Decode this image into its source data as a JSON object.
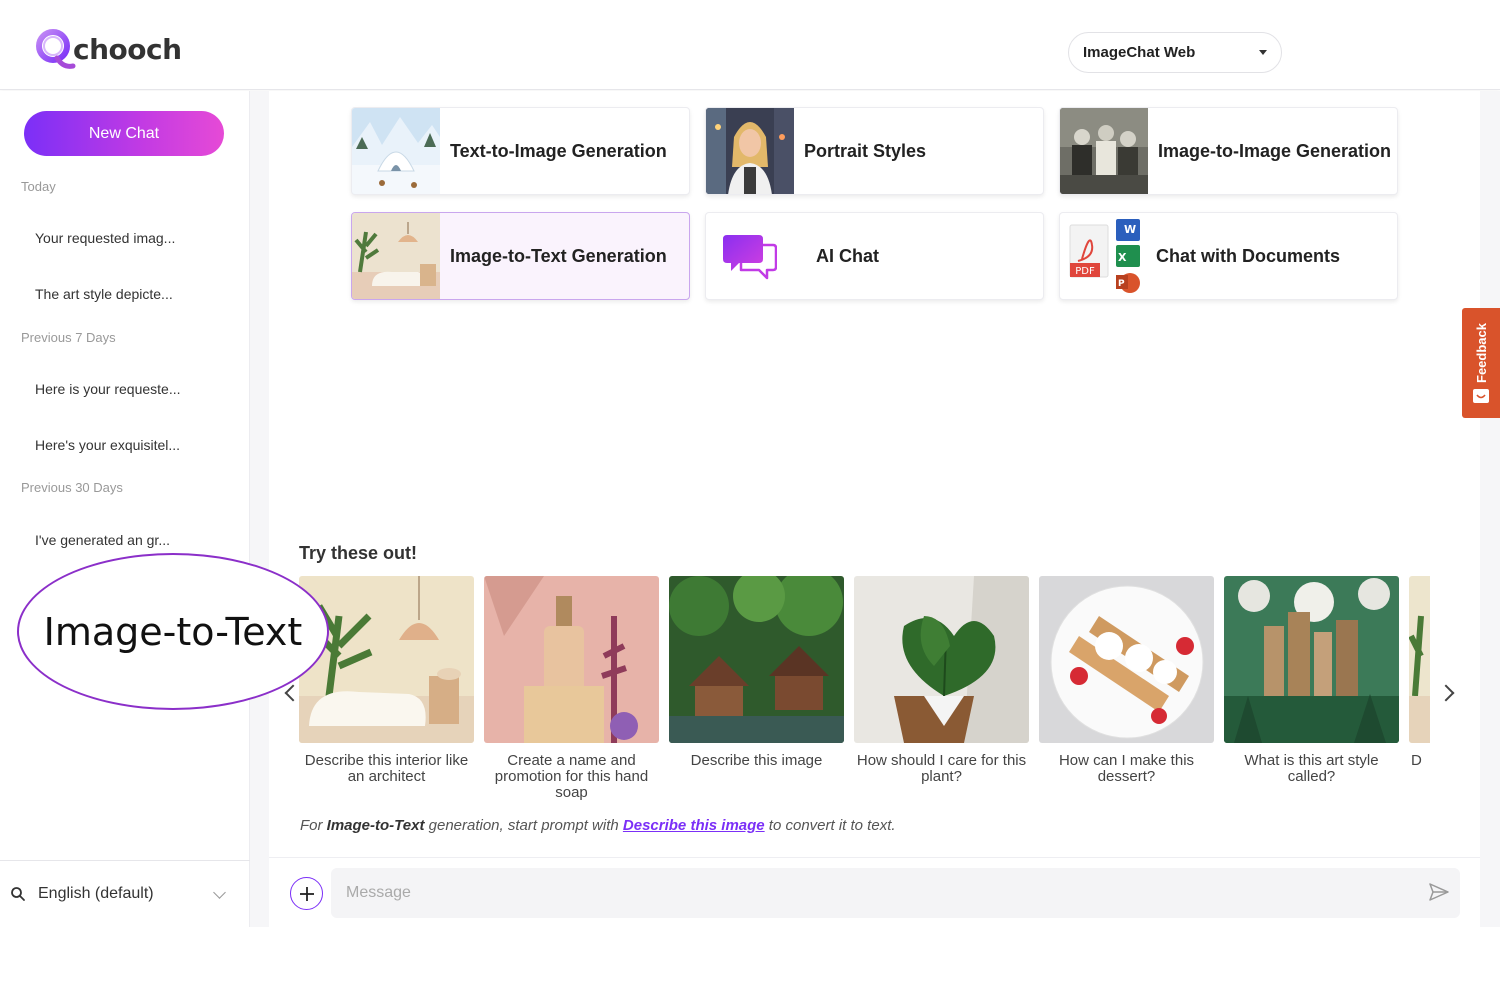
{
  "brand": {
    "name": "chooch"
  },
  "header": {
    "model_select": "ImageChat Web"
  },
  "sidebar": {
    "new_chat_label": "New Chat",
    "sections": [
      {
        "title": "Today",
        "items": [
          "Your requested imag...",
          "The art style depicte..."
        ]
      },
      {
        "title": "Previous 7 Days",
        "items": [
          "Here is your requeste...",
          "Here's your exquisitel..."
        ]
      },
      {
        "title": "Previous 30 Days",
        "items": [
          "I've generated an gr..."
        ]
      }
    ],
    "language": "English (default)"
  },
  "cards": [
    {
      "label": "Text-to-Image Generation"
    },
    {
      "label": "Portrait Styles"
    },
    {
      "label": "Image-to-Image Generation"
    },
    {
      "label": "Image-to-Text Generation"
    },
    {
      "label": "AI Chat"
    },
    {
      "label": "Chat with Documents"
    }
  ],
  "try_title": "Try these out!",
  "examples": [
    "Describe this interior like an architect",
    "Create a name and promotion for this hand soap",
    "Describe this image",
    "How should I care for this plant?",
    "How can I make this dessert?",
    "What is this art style called?",
    "D"
  ],
  "hint": {
    "prefix": "For ",
    "bold": "Image-to-Text",
    "middle": " generation, start prompt with ",
    "highlight": "Describe this image",
    "suffix": " to convert it to text."
  },
  "composer": {
    "placeholder": "Message"
  },
  "feedback_label": "Feedback",
  "callout_label": "Image-to-Text",
  "colors": {
    "accent": "#7b2ff7",
    "accent_pink": "#e64ad6",
    "feedback": "#d9532b"
  }
}
